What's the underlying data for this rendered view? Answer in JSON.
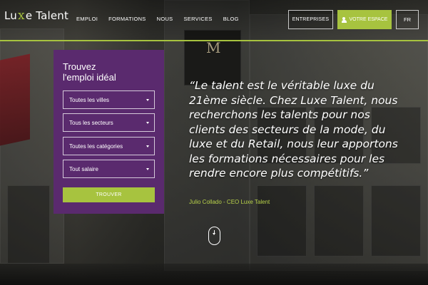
{
  "brand": {
    "logo_left": "Lu",
    "logo_x": "x",
    "logo_right": "e Talent",
    "accent": "#a7c33f",
    "panel_color": "#5a2a6e"
  },
  "nav": {
    "items": [
      "EMPLOI",
      "FORMATIONS",
      "NOUS",
      "SERVICES",
      "BLOG"
    ]
  },
  "header": {
    "entreprises_label": "ENTREPRISES",
    "espace_label": "VOTRE ESPACE",
    "espace_icon": "user-icon",
    "lang_label": "FR"
  },
  "search": {
    "title_line1": "Trouvez",
    "title_line2": "l'emploi idéal",
    "selects": [
      "Toutes les villes",
      "Tous les secteurs",
      "Toutes les catégories",
      "Tout salaire"
    ],
    "submit_label": "TROUVER"
  },
  "hero": {
    "quote": "“Le talent est le véritable luxe du 21ème siècle. Chez Luxe Talent, nous recherchons les talents pour nos clients des secteurs de la mode, du luxe et du Retail, nous leur apportons les formations nécessaires pour les rendre encore plus compétitifs.”",
    "author": "Julio Collado - CEO Luxe Talent",
    "sign_letter": "M",
    "scroll_icon": "scroll-down-icon"
  }
}
